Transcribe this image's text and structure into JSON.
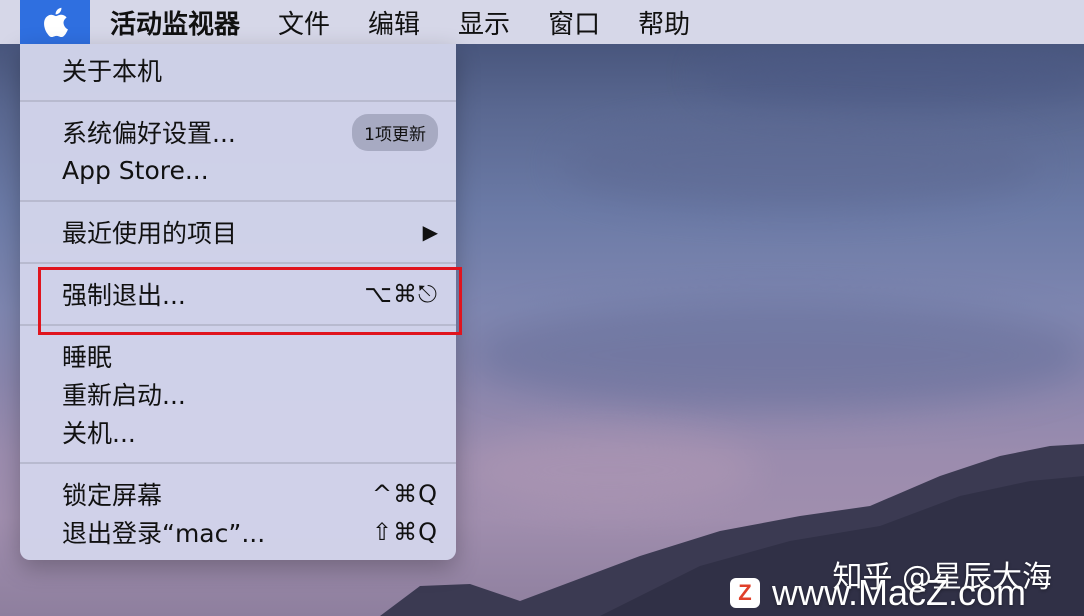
{
  "menubar": {
    "apple_icon": "apple-logo-icon",
    "app_name": "活动监视器",
    "items": [
      "文件",
      "编辑",
      "显示",
      "窗口",
      "帮助"
    ]
  },
  "apple_menu": {
    "about": "关于本机",
    "system_prefs": "系统偏好设置...",
    "system_prefs_badge": "1项更新",
    "app_store": "App Store...",
    "recent_items": "最近使用的项目",
    "recent_items_arrow": "▶",
    "force_quit": "强制退出...",
    "force_quit_shortcut": "⌥⌘⎋",
    "sleep": "睡眠",
    "restart": "重新启动...",
    "shutdown": "关机...",
    "lock_screen": "锁定屏幕",
    "lock_screen_shortcut": "^⌘Q",
    "logout": "退出登录“mac”...",
    "logout_shortcut": "⇧⌘Q"
  },
  "watermark": {
    "zhihu": "知乎 @星辰大海",
    "logo_letter": "Z",
    "url": "www.MacZ.com"
  },
  "colors": {
    "highlight_border": "#e0141e",
    "apple_menu_active": "#2f6fe0"
  }
}
